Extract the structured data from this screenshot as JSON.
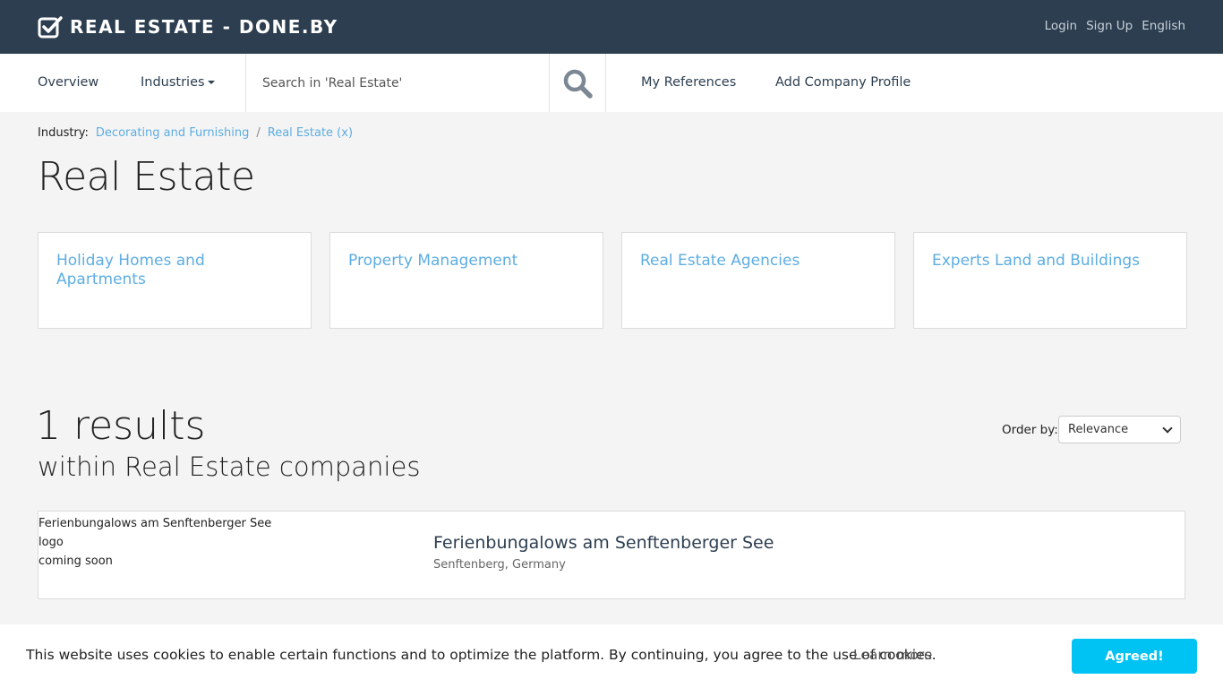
{
  "topbar": {
    "brand": "REAL ESTATE - DONE.BY",
    "links": [
      "Login",
      "Sign Up",
      "English"
    ]
  },
  "nav": {
    "overview": "Overview",
    "industries": "Industries",
    "search_placeholder": "Search in 'Real Estate'",
    "my_references": "My References",
    "add_company_profile": "Add Company Profile"
  },
  "breadcrumb": {
    "label": "Industry:",
    "items": [
      "Decorating and Furnishing",
      "Real Estate (x)"
    ],
    "separator": "/"
  },
  "page_title": "Real Estate",
  "categories": [
    "Holiday Homes and Apartments",
    "Property Management",
    "Real Estate Agencies",
    "Experts Land and Buildings"
  ],
  "results": {
    "count": "1 results",
    "subtitle": "within Real Estate companies",
    "order_label": "Order by:",
    "order_value": "Relevance",
    "items": [
      {
        "logo_alt": "Ferienbungalows am Senftenberger See logo",
        "logo_note": "coming soon",
        "name": "Ferienbungalows am Senftenberger See",
        "location": "Senftenberg, Germany"
      }
    ]
  },
  "cookie": {
    "message": "This website uses cookies to enable certain functions and to optimize the platform. By continuing, you agree to the use of cookies.",
    "learn_more": "Learn more",
    "button": "Agreed!"
  },
  "colors": {
    "topbar": "#2c3e50",
    "link": "#5dade2",
    "cookie_button": "#00c3f4"
  }
}
